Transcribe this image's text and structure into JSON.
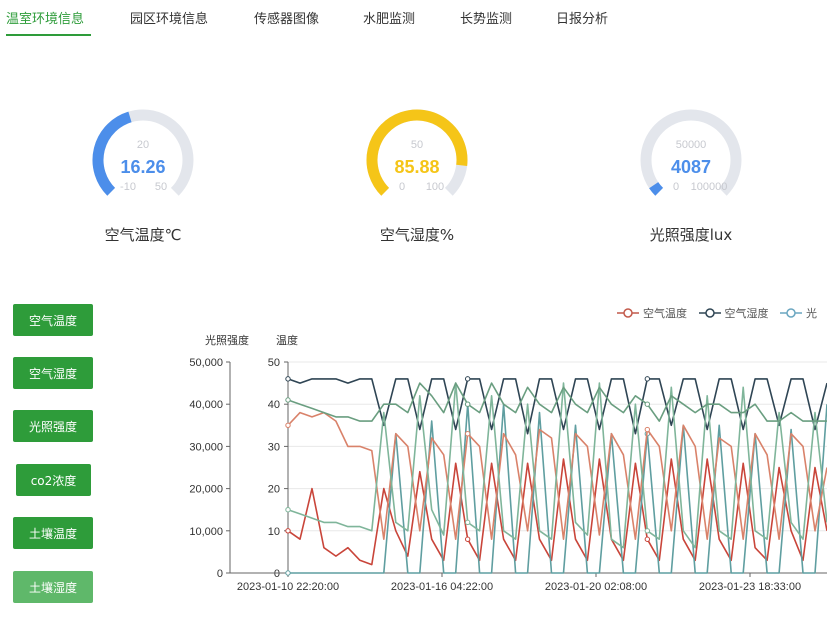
{
  "tabs": [
    "温室环境信息",
    "园区环境信息",
    "传感器图像",
    "水肥监测",
    "长势监测",
    "日报分析"
  ],
  "active_tab": 0,
  "gauges": [
    {
      "value": "16.26",
      "label": "空气温度℃",
      "tick_top": "20",
      "tick_min": "-10",
      "tick_max": "50",
      "value_num": 16.26,
      "min": -10,
      "max": 50,
      "color": "#4c8eea"
    },
    {
      "value": "85.88",
      "label": "空气湿度%",
      "tick_top": "50",
      "tick_min": "0",
      "tick_max": "100",
      "value_num": 85.88,
      "min": 0,
      "max": 100,
      "color": "#f5c518"
    },
    {
      "value": "4087",
      "label": "光照强度lux",
      "tick_top": "50000",
      "tick_min": "0",
      "tick_max": "100000",
      "value_num": 4087,
      "min": 0,
      "max": 100000,
      "color": "#4c8eea"
    }
  ],
  "buttons": [
    "空气温度",
    "空气湿度",
    "光照强度",
    "co2浓度",
    "土壤温度",
    "土壤湿度"
  ],
  "chart_data": {
    "type": "line",
    "y_left_label": "光照强度",
    "y_right_label": "温度",
    "y_left_ticks": [
      "50,000",
      "40,000",
      "30,000",
      "20,000",
      "10,000",
      "0"
    ],
    "y_right_ticks": [
      "50",
      "40",
      "30",
      "20",
      "10",
      "0"
    ],
    "x_ticks": [
      "2023-01-10 22:20:00",
      "2023-01-16 04:22:00",
      "2023-01-20 02:08:00",
      "2023-01-23 18:33:00"
    ],
    "ylim_left": [
      0,
      50000
    ],
    "ylim_right": [
      0,
      50
    ],
    "legend": [
      {
        "name": "空气温度",
        "color": "#c2594a"
      },
      {
        "name": "空气湿度",
        "color": "#2f4554"
      },
      {
        "name": "光",
        "color": "#6aa6c0"
      }
    ],
    "series": [
      {
        "name": "空气温度",
        "color": "#c9453a",
        "axis": "right",
        "values": [
          10,
          8,
          20,
          6,
          4,
          6,
          3,
          2,
          20,
          10,
          4,
          24,
          8,
          3,
          26,
          8,
          3,
          26,
          8,
          3,
          26,
          8,
          3,
          27,
          8,
          3,
          27,
          8,
          3,
          26,
          8,
          3,
          27,
          8,
          3,
          27,
          8,
          3,
          26,
          6,
          3,
          25,
          10,
          3,
          25,
          10
        ]
      },
      {
        "name": "空气湿度",
        "color": "#2f4554",
        "axis": "right",
        "values": [
          46,
          45,
          46,
          46,
          46,
          45,
          46,
          46,
          35,
          46,
          46,
          34,
          46,
          46,
          34,
          46,
          46,
          34,
          46,
          46,
          33,
          46,
          46,
          34,
          46,
          46,
          34,
          46,
          46,
          33,
          46,
          46,
          35,
          46,
          46,
          34,
          46,
          46,
          34,
          46,
          46,
          35,
          46,
          46,
          34,
          45
        ]
      },
      {
        "name": "光照强度",
        "color": "#5f9ea0",
        "axis": "left",
        "values": [
          0,
          0,
          0,
          0,
          0,
          0,
          0,
          0,
          0,
          33000,
          0,
          0,
          36000,
          0,
          0,
          40000,
          0,
          0,
          40000,
          0,
          0,
          38000,
          0,
          0,
          35000,
          0,
          0,
          33000,
          0,
          0,
          33000,
          0,
          0,
          35000,
          0,
          0,
          35000,
          0,
          0,
          33000,
          0,
          0,
          34000,
          0,
          0,
          40000
        ]
      },
      {
        "name": "土壤温度",
        "color": "#d9826a",
        "axis": "right",
        "values": [
          35,
          38,
          37,
          38,
          36,
          30,
          30,
          29,
          8,
          33,
          30,
          10,
          32,
          28,
          8,
          33,
          30,
          8,
          33,
          28,
          10,
          34,
          32,
          8,
          33,
          30,
          9,
          33,
          28,
          8,
          34,
          30,
          10,
          35,
          30,
          8,
          32,
          30,
          8,
          33,
          28,
          8,
          33,
          30,
          10,
          25
        ]
      },
      {
        "name": "土壤湿度",
        "color": "#7fb59a",
        "axis": "right",
        "values": [
          15,
          14,
          13,
          12,
          12,
          11,
          11,
          10,
          38,
          12,
          10,
          42,
          15,
          9,
          45,
          12,
          10,
          42,
          10,
          8,
          40,
          10,
          8,
          45,
          12,
          9,
          45,
          8,
          6,
          40,
          10,
          8,
          44,
          10,
          6,
          42,
          10,
          8,
          44,
          10,
          8,
          38,
          12,
          8,
          38,
          12
        ]
      },
      {
        "name": "co2浓度",
        "color": "#6a9e80",
        "axis": "right",
        "values": [
          41,
          40,
          39,
          38,
          37,
          37,
          36,
          36,
          40,
          40,
          38,
          45,
          42,
          38,
          45,
          40,
          38,
          45,
          40,
          38,
          44,
          40,
          38,
          44,
          40,
          38,
          44,
          40,
          38,
          42,
          40,
          36,
          42,
          40,
          38,
          40,
          40,
          38,
          38,
          40,
          36,
          36,
          38,
          36,
          36,
          36
        ]
      }
    ]
  }
}
